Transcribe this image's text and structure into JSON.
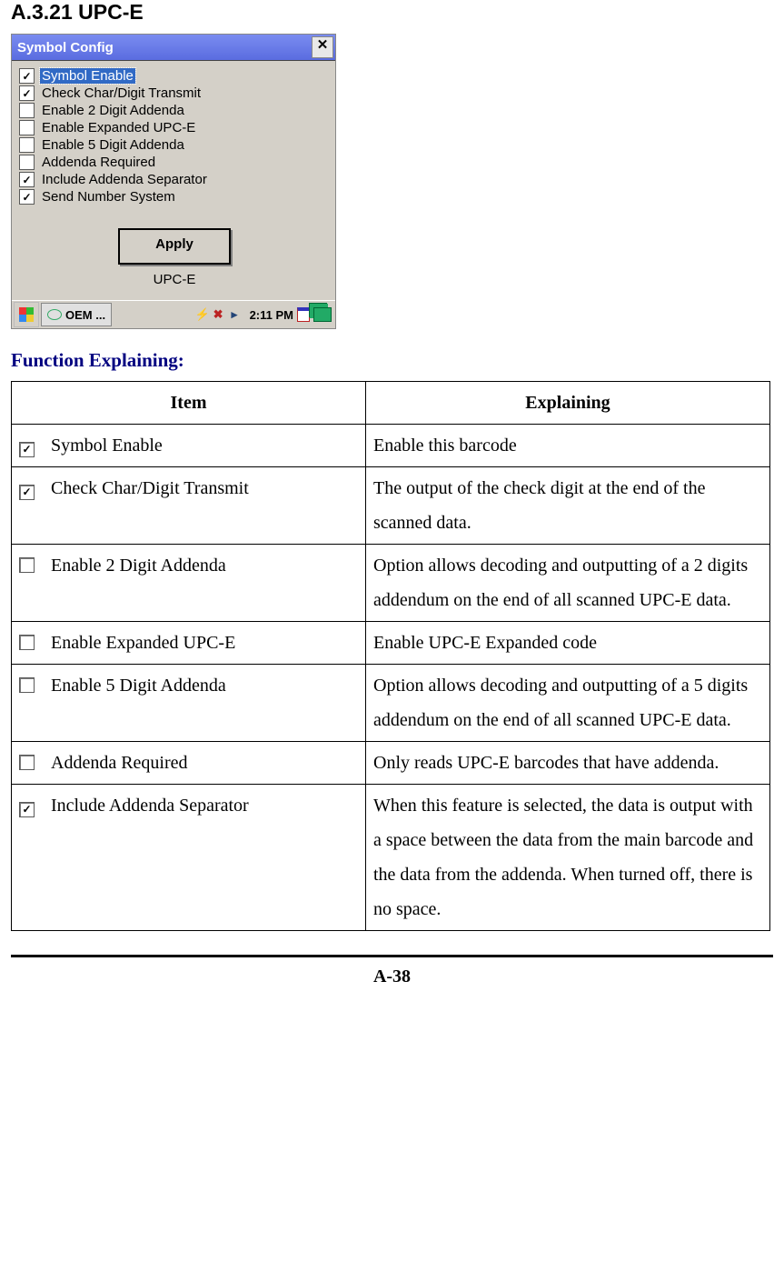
{
  "section_heading": "A.3.21 UPC-E",
  "dialog": {
    "title": "Symbol Config",
    "items": [
      {
        "label": "Symbol Enable",
        "checked": true,
        "selected": true
      },
      {
        "label": "Check Char/Digit Transmit",
        "checked": true,
        "selected": false
      },
      {
        "label": "Enable 2 Digit Addenda",
        "checked": false,
        "selected": false
      },
      {
        "label": "Enable Expanded UPC-E",
        "checked": false,
        "selected": false
      },
      {
        "label": "Enable 5 Digit Addenda",
        "checked": false,
        "selected": false
      },
      {
        "label": "Addenda Required",
        "checked": false,
        "selected": false
      },
      {
        "label": "Include Addenda Separator",
        "checked": true,
        "selected": false
      },
      {
        "label": "Send Number System",
        "checked": true,
        "selected": false
      }
    ],
    "apply_label": "Apply",
    "footer_label": "UPC-E"
  },
  "taskbar": {
    "app_btn": "OEM ...",
    "time": "2:11 PM"
  },
  "function_explaining_heading": "Function Explaining:",
  "table": {
    "headers": {
      "item": "Item",
      "explaining": "Explaining"
    },
    "rows": [
      {
        "checked": true,
        "item": "Symbol Enable",
        "explaining": "Enable this barcode"
      },
      {
        "checked": true,
        "item": "Check Char/Digit Transmit",
        "explaining": "The output of the check digit at the end of the scanned data."
      },
      {
        "checked": false,
        "item": "Enable 2 Digit Addenda",
        "explaining": "Option allows decoding and outputting of a 2 digits addendum on the end of all scanned UPC-E data."
      },
      {
        "checked": false,
        "item": "Enable Expanded UPC-E",
        "explaining": "Enable UPC-E Expanded code"
      },
      {
        "checked": false,
        "item": "Enable 5 Digit Addenda",
        "explaining": "Option allows decoding and outputting of a 5 digits addendum on the end of all scanned UPC-E data."
      },
      {
        "checked": false,
        "item": "Addenda Required",
        "explaining": "Only reads UPC-E barcodes that have addenda."
      },
      {
        "checked": true,
        "item": "Include Addenda Separator",
        "explaining": "When this feature is selected, the data is output with a space between the data from the main barcode and the data from the addenda. When turned off, there is no space."
      }
    ]
  },
  "page_number": "A-38"
}
